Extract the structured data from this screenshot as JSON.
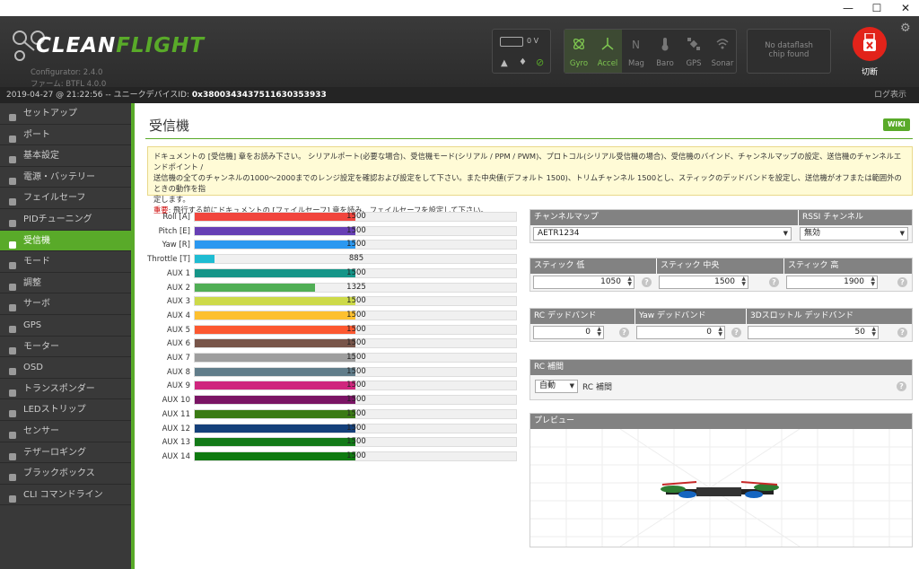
{
  "window": {
    "minimize": "—",
    "maximize": "☐",
    "close": "✕"
  },
  "header": {
    "logo_clean": "CLEAN",
    "logo_flight": "FLIGHT",
    "configurator": "Configurator: 2.4.0",
    "firmware": "ファーム: BTFL 4.0.0",
    "battery_voltage": "0 V",
    "sensors": [
      {
        "label": "Gyro",
        "icon": "gyro-icon",
        "active": true
      },
      {
        "label": "Accel",
        "icon": "accel-icon",
        "active": true
      },
      {
        "label": "Mag",
        "icon": "mag-icon",
        "active": false
      },
      {
        "label": "Baro",
        "icon": "baro-icon",
        "active": false
      },
      {
        "label": "GPS",
        "icon": "gps-icon",
        "active": false
      },
      {
        "label": "Sonar",
        "icon": "sonar-icon",
        "active": false
      }
    ],
    "dataflash_line1": "No dataflash",
    "dataflash_line2": "chip found",
    "disconnect_label": "切断"
  },
  "statusline": {
    "datetime": "2019-04-27 @ 21:22:56",
    "device_id_label": " -- ユニークデバイスID: ",
    "device_id": "0x380034343751163035393​3",
    "log_show": "ログ表示"
  },
  "sidebar": {
    "items": [
      {
        "label": "セットアップ",
        "icon": "wrench-icon"
      },
      {
        "label": "ポート",
        "icon": "plug-icon"
      },
      {
        "label": "基本設定",
        "icon": "gear-icon"
      },
      {
        "label": "電源・バッテリー",
        "icon": "battery-icon"
      },
      {
        "label": "フェイルセーフ",
        "icon": "parachute-icon"
      },
      {
        "label": "PIDチューニング",
        "icon": "sitemap-icon"
      },
      {
        "label": "受信機",
        "icon": "receiver-icon",
        "active": true
      },
      {
        "label": "モード",
        "icon": "toggle-icon"
      },
      {
        "label": "調整",
        "icon": "sliders-icon"
      },
      {
        "label": "サーボ",
        "icon": "servo-icon"
      },
      {
        "label": "GPS",
        "icon": "satellite-icon"
      },
      {
        "label": "モーター",
        "icon": "motor-icon"
      },
      {
        "label": "OSD",
        "icon": "osd-icon"
      },
      {
        "label": "トランスポンダー",
        "icon": "transponder-icon"
      },
      {
        "label": "LEDストリップ",
        "icon": "led-icon"
      },
      {
        "label": "センサー",
        "icon": "pulse-icon"
      },
      {
        "label": "テザーロギング",
        "icon": "tether-icon"
      },
      {
        "label": "ブラックボックス",
        "icon": "blackbox-icon"
      },
      {
        "label": "CLI コマンドライン",
        "icon": "terminal-icon"
      }
    ]
  },
  "main": {
    "title": "受信機",
    "wiki": "WIKI",
    "note_line1": "ドキュメントの [受信機] 章をお読み下さい。 シリアルポート(必要な場合)、受信機モード(シリアル / PPM / PWM)、プロトコル(シリアル受信機の場合)、受信機のバインド、チャンネルマップの設定、送信機のチャンネルエンドポイント /",
    "note_line2": "送信機の全てのチャンネルの1000～2000までのレンジ設定を確認および設定をして下さい。また中央値(デフォルト 1500)、トリムチャンネル 1500とし、スティックのデッドバンドを設定し、送信機がオフまたは範囲外のときの動作を指",
    "note_line3": "定します。",
    "note_warn": "重要",
    "note_line4": ": 飛行する前にドキュメントの [フェイルセーフ] 章を読み、フェイルセーフを設定して下さい。"
  },
  "channels": [
    {
      "label": "Roll [A]",
      "value": 1500,
      "color": "#f1453d"
    },
    {
      "label": "Pitch [E]",
      "value": 1500,
      "color": "#673fb4"
    },
    {
      "label": "Yaw [R]",
      "value": 1500,
      "color": "#2b98f0"
    },
    {
      "label": "Throttle [T]",
      "value": 885,
      "color": "#1fbcd2"
    },
    {
      "label": "AUX 1",
      "value": 1500,
      "color": "#159588"
    },
    {
      "label": "AUX 2",
      "value": 1325,
      "color": "#50ae55"
    },
    {
      "label": "AUX 3",
      "value": 1500,
      "color": "#cdda49"
    },
    {
      "label": "AUX 4",
      "value": 1500,
      "color": "#fdc02f"
    },
    {
      "label": "AUX 5",
      "value": 1500,
      "color": "#fc5830"
    },
    {
      "label": "AUX 6",
      "value": 1500,
      "color": "#785549"
    },
    {
      "label": "AUX 7",
      "value": 1500,
      "color": "#9e9e9e"
    },
    {
      "label": "AUX 8",
      "value": 1500,
      "color": "#617d8a"
    },
    {
      "label": "AUX 9",
      "value": 1500,
      "color": "#cf267d"
    },
    {
      "label": "AUX 10",
      "value": 1500,
      "color": "#7a1464"
    },
    {
      "label": "AUX 11",
      "value": 1500,
      "color": "#3a7a14"
    },
    {
      "label": "AUX 12",
      "value": 1500,
      "color": "#14407a"
    },
    {
      "label": "AUX 13",
      "value": 1500,
      "color": "#137a18"
    },
    {
      "label": "AUX 14",
      "value": 1500,
      "color": "#0f7a10"
    }
  ],
  "channel_range": {
    "min": 800,
    "max": 2200
  },
  "settings": {
    "channel_map_label": "チャンネルマップ",
    "channel_map_value": "AETR1234",
    "rssi_label": "RSSI チャンネル",
    "rssi_value": "無効",
    "stick_low_label": "スティック 低",
    "stick_low": "1050",
    "stick_center_label": "スティック 中央",
    "stick_center": "1500",
    "stick_high_label": "スティック 高",
    "stick_high": "1900",
    "rc_deadband_label": "RC デッドバンド",
    "rc_deadband": "0",
    "yaw_deadband_label": "Yaw デッドバンド",
    "yaw_deadband": "0",
    "throttle_deadband_label": "3Dスロットル デッドバンド",
    "throttle_deadband": "50",
    "rc_interp_label": "RC 補間",
    "rc_interp_value": "自動",
    "rc_interp_text": "RC 補間",
    "preview_label": "プレビュー",
    "help": "?"
  },
  "colors": {
    "accent": "#59aa29",
    "disconnect": "#e2231a"
  }
}
